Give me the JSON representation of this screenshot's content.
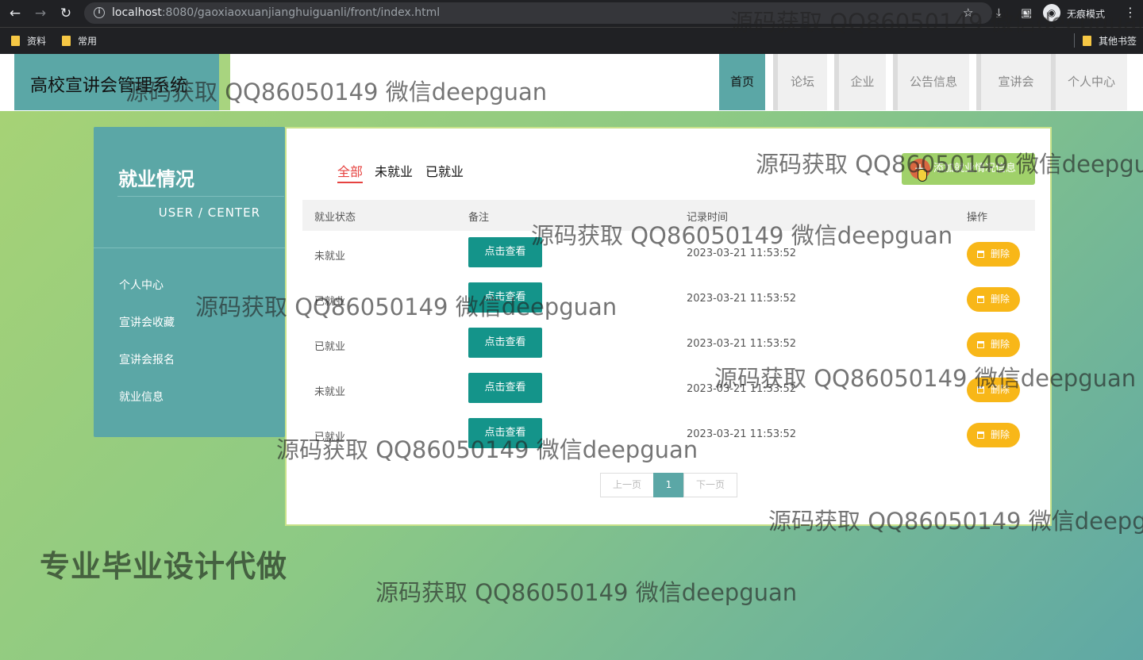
{
  "browser": {
    "url_host": "localhost",
    "url_path": ":8080/gaoxiaoxuanjianghuiguanli/front/index.html",
    "incognito_label": "无痕模式",
    "bookmarks": [
      "资料",
      "常用"
    ],
    "other_bookmarks": "其他书签"
  },
  "header": {
    "title": "高校宣讲会管理系统",
    "nav": [
      "首页",
      "论坛",
      "企业",
      "公告信息",
      "宣讲会",
      "个人中心"
    ]
  },
  "sidebar": {
    "title": "就业情况",
    "subtitle": "USER / CENTER",
    "items": [
      "个人中心",
      "宣讲会收藏",
      "宣讲会报名",
      "就业信息"
    ]
  },
  "tabs": [
    "全部",
    "未就业",
    "已就业"
  ],
  "add_button": "添加就业情况信息",
  "table": {
    "headers": [
      "就业状态",
      "备注",
      "记录时间",
      "操作"
    ],
    "view_label": "点击查看",
    "delete_label": "删除",
    "rows": [
      {
        "status": "未就业",
        "time": "2023-03-21 11:53:52"
      },
      {
        "status": "已就业",
        "time": "2023-03-21 11:53:52"
      },
      {
        "status": "已就业",
        "time": "2023-03-21 11:53:52"
      },
      {
        "status": "未就业",
        "time": "2023-03-21 11:53:52"
      },
      {
        "status": "已就业",
        "time": "2023-03-21 11:53:52"
      }
    ]
  },
  "pagination": {
    "prev": "上一页",
    "current": "1",
    "next": "下一页"
  },
  "promo": "专业毕业设计代做",
  "watermark": "源码获取 QQ86050149 微信deepguan",
  "colors": {
    "teal": "#5ba7a6",
    "view_button": "#14948a",
    "delete_button": "#f8b718",
    "active_tab": "#e64340",
    "add_button": "#a0d16a"
  }
}
